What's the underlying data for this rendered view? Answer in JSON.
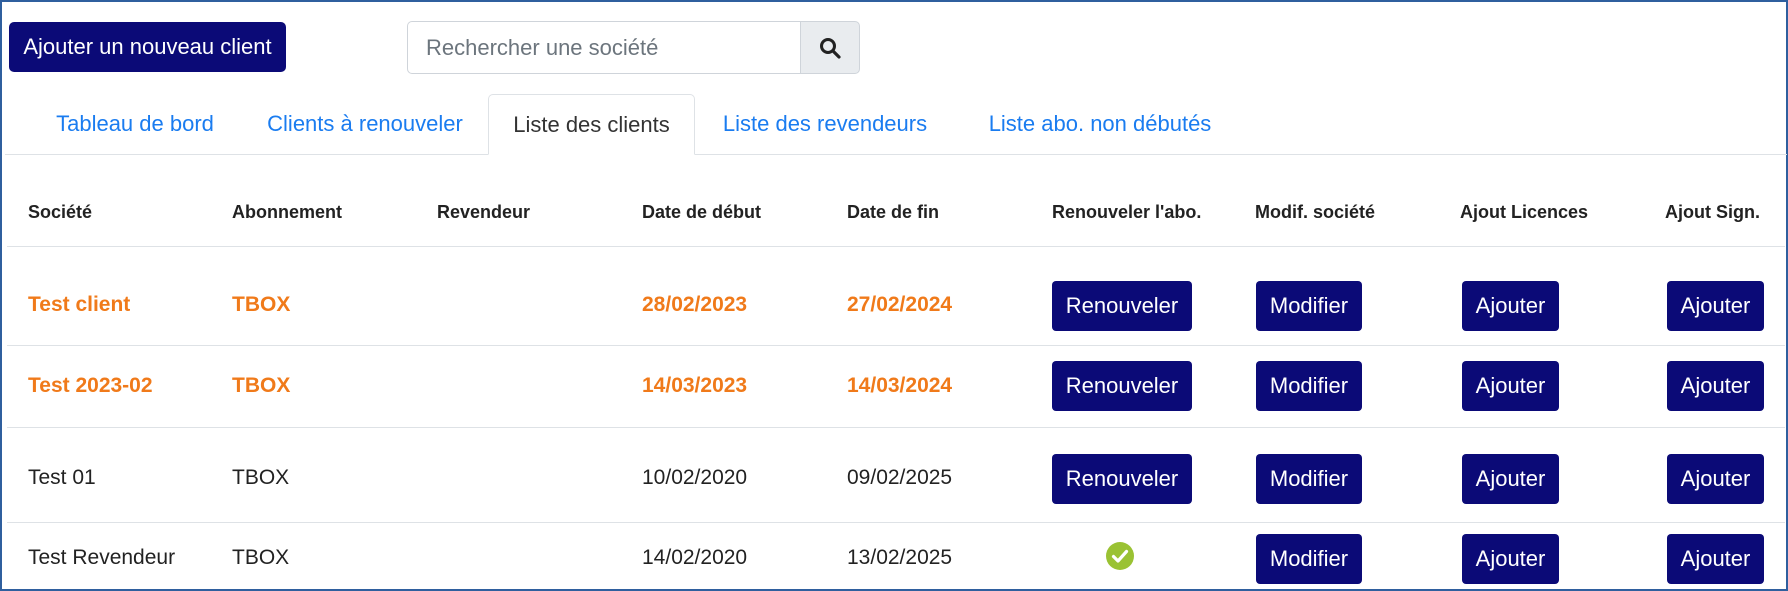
{
  "toolbar": {
    "new_client_label": "Ajouter un nouveau client",
    "search_placeholder": "Rechercher une société",
    "search_icon": "search-icon"
  },
  "tabs": [
    {
      "label": "Tableau de bord",
      "active": false
    },
    {
      "label": "Clients à renouveler",
      "active": false
    },
    {
      "label": "Liste des clients",
      "active": true
    },
    {
      "label": "Liste des revendeurs",
      "active": false
    },
    {
      "label": "Liste abo. non débutés",
      "active": false
    }
  ],
  "table": {
    "headers": [
      "Société",
      "Abonnement",
      "Revendeur",
      "Date de début",
      "Date de fin",
      "Renouveler l'abo.",
      "Modif. société",
      "Ajout Licences",
      "Ajout Sign."
    ],
    "rows": [
      {
        "societe": "Test client",
        "abonnement": "TBOX",
        "revendeur": "",
        "debut": "28/02/2023",
        "fin": "27/02/2024",
        "renew": "Renouveler",
        "modify": "Modifier",
        "licences": "Ajouter",
        "sign": "Ajouter",
        "highlight": true
      },
      {
        "societe": "Test 2023-02",
        "abonnement": "TBOX",
        "revendeur": "",
        "debut": "14/03/2023",
        "fin": "14/03/2024",
        "renew": "Renouveler",
        "modify": "Modifier",
        "licences": "Ajouter",
        "sign": "Ajouter",
        "highlight": true
      },
      {
        "societe": "Test 01",
        "abonnement": "TBOX",
        "revendeur": "",
        "debut": "10/02/2020",
        "fin": "09/02/2025",
        "renew": "Renouveler",
        "modify": "Modifier",
        "licences": "Ajouter",
        "sign": "Ajouter",
        "highlight": false
      },
      {
        "societe": "Test Revendeur",
        "abonnement": "TBOX",
        "revendeur": "",
        "debut": "14/02/2020",
        "fin": "13/02/2025",
        "renew_icon": "check-circle-icon",
        "modify": "Modifier",
        "licences": "Ajouter",
        "sign": "Ajouter",
        "highlight": false
      }
    ]
  },
  "colors": {
    "primary_button": "#0b0a77",
    "highlight_text": "#f07a1a",
    "tab_link": "#1a7cf0",
    "check": "#9ac233",
    "frame_border": "#2f5f9e"
  }
}
